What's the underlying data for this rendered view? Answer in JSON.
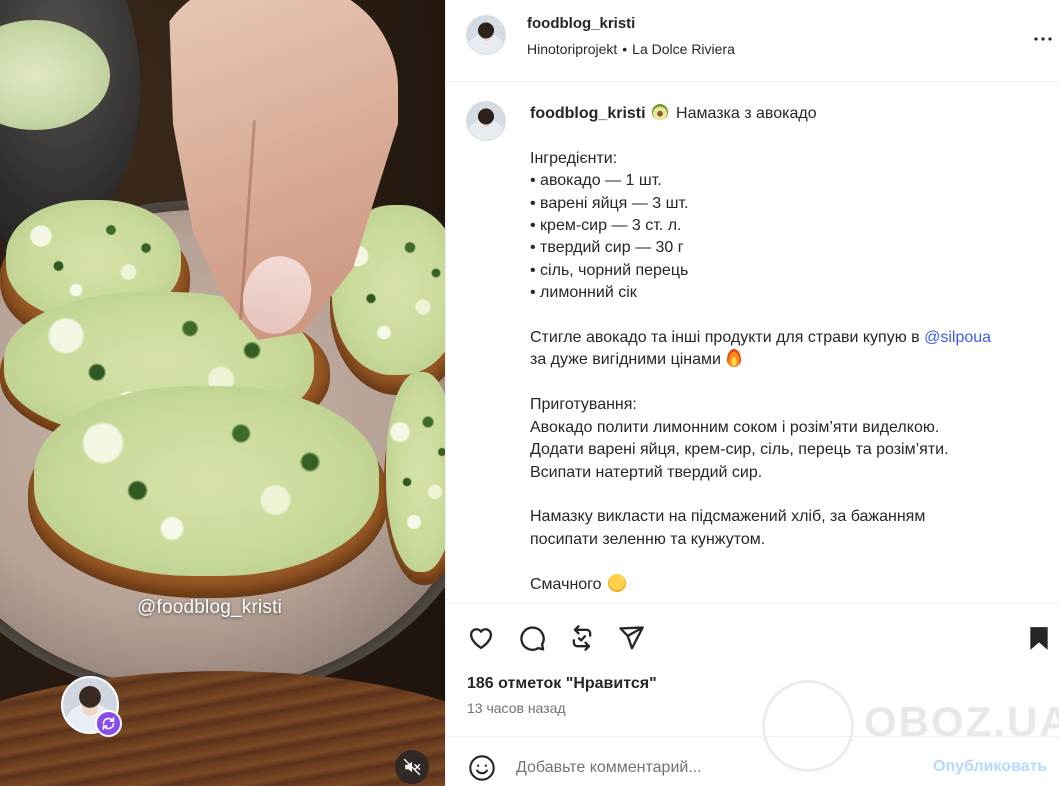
{
  "media": {
    "watermark": "@foodblog_kristi",
    "icons": {
      "remix": "remix-icon",
      "mute": "speaker-muted-icon"
    }
  },
  "header": {
    "username": "foodblog_kristi",
    "audio_artist": "Hinotoriprojekt",
    "separator": "•",
    "audio_title": "La Dolce Riviera",
    "more_icon": "more-horizontal-icon"
  },
  "caption": {
    "username": "foodblog_kristi",
    "title": "Намазка з авокадо",
    "ingredients_block": "Інгредієнти:\n• авокадо — 1 шт.\n• варені яйця — 3 шт.\n• крем-сир — 3 ст. л.\n• твердий сир — 30 г\n• сіль, чорний перець\n• лимонний сік",
    "promo_text": "Стиглe авокадо та інші продукти для страви купую в",
    "mention": "@silpoua",
    "promo_text_2": "за дуже вигідними цінами",
    "method_block": "Приготування:\nАвокадо полити лимонним соком і розім’яти виделкою.\nДодати варені яйця, крем-сир, сіль, перець та розім’яти.\nВсипати натертий твердий сир.",
    "serve_block": "Намазку викласти на підсмажений хліб, за бажанням\nпосипати зеленню та кунжутом.",
    "closing": "Смачного"
  },
  "actions": {
    "icons": [
      "heart-icon",
      "comment-icon",
      "repost-icon",
      "share-icon",
      "bookmark-icon"
    ]
  },
  "stats": {
    "likes": "186 отметок \"Нравится\"",
    "time_ago": "13 часов назад"
  },
  "comment": {
    "placeholder": "Добавьте комментарий...",
    "publish_label": "Опубликовать"
  },
  "overlay": {
    "brand": "OBOZ.UA"
  },
  "colors": {
    "link": "#3d5af1",
    "publish_disabled": "#b3dbff",
    "remix_badge": "#8a4be8"
  }
}
